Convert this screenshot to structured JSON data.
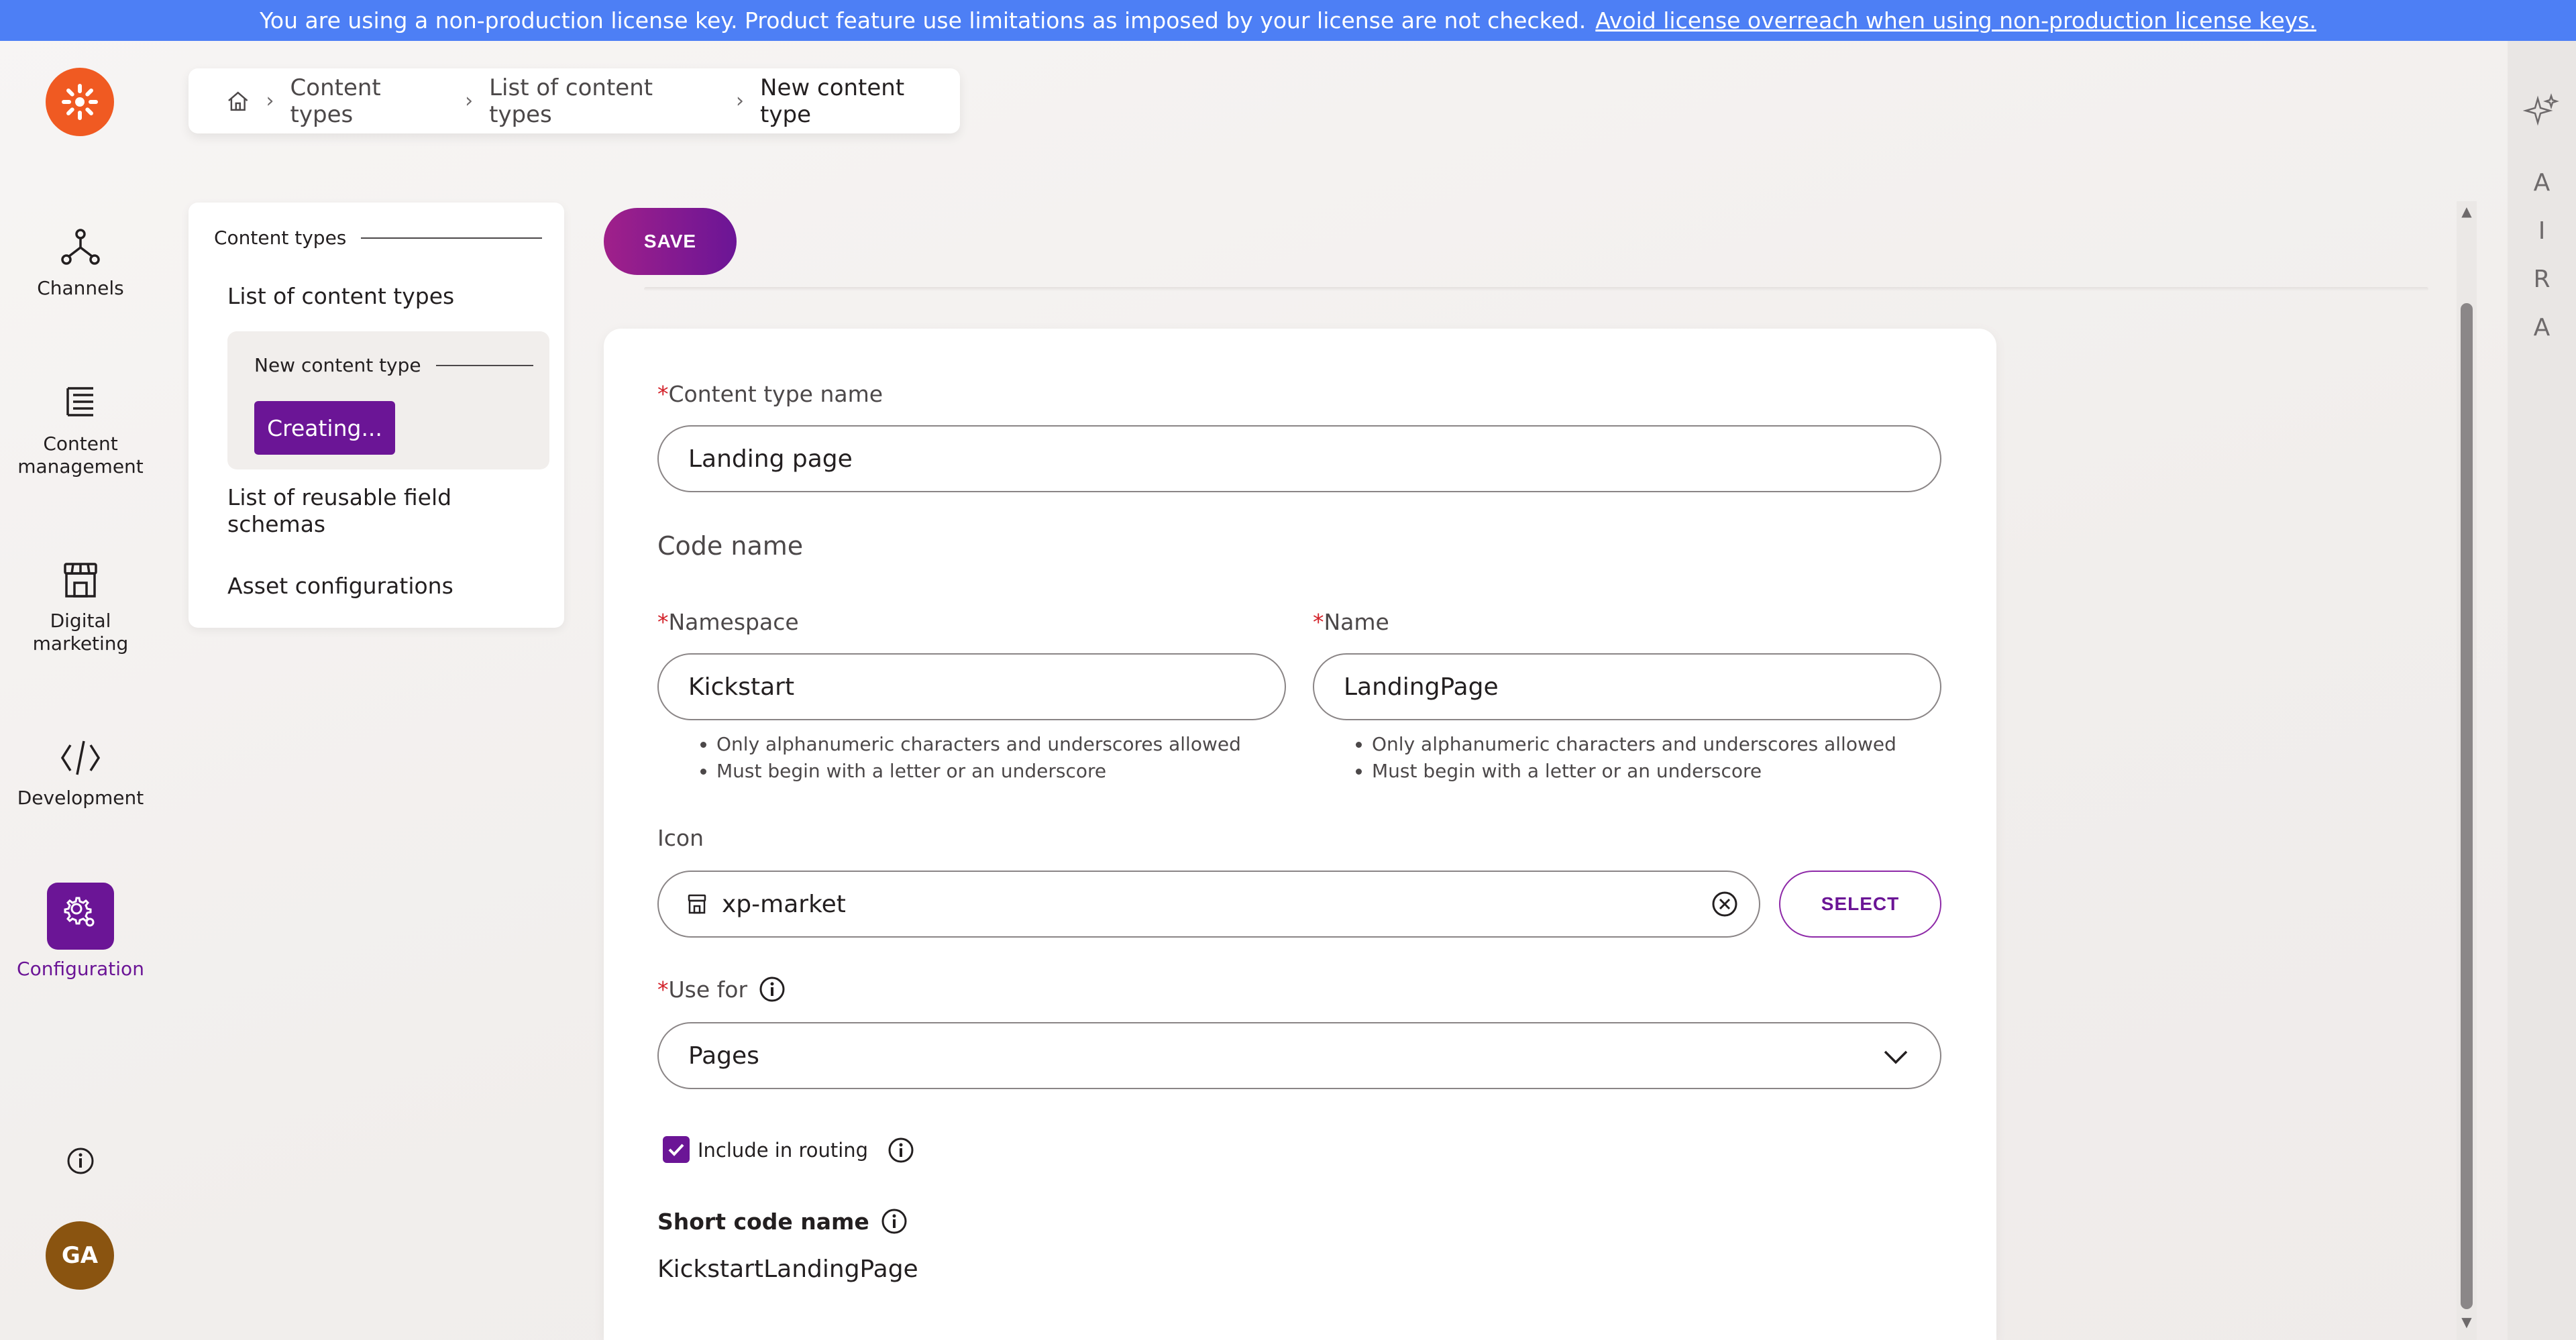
{
  "banner": {
    "text": "You are using a non-production license key. Product feature use limitations as imposed by your license are not checked.",
    "link": "Avoid license overreach when using non-production license keys."
  },
  "leftnav": {
    "items": [
      {
        "label": "Channels",
        "icon": "channels-icon"
      },
      {
        "label": "Content management",
        "icon": "content-management-icon"
      },
      {
        "label": "Digital marketing",
        "icon": "digital-marketing-icon"
      },
      {
        "label": "Development",
        "icon": "code-icon"
      },
      {
        "label": "Configuration",
        "icon": "gear-icon"
      }
    ],
    "avatar": "GA"
  },
  "breadcrumb": {
    "items": [
      "Content types",
      "List of content types",
      "New content type"
    ]
  },
  "subnav": {
    "heading": "Content types",
    "list_link": "List of content types",
    "group_heading": "New content type",
    "creating": "Creating...",
    "reusable_link": "List of reusable field schemas",
    "asset_link": "Asset configurations"
  },
  "toolbar": {
    "save_label": "SAVE"
  },
  "form": {
    "required_mark": "*",
    "content_type_name_label": "Content type name",
    "content_type_name_value": "Landing page",
    "code_name_title": "Code name",
    "namespace_label": "Namespace",
    "namespace_value": "Kickstart",
    "name_label": "Name",
    "name_value": "LandingPage",
    "hints": [
      "Only alphanumeric characters and underscores allowed",
      "Must begin with a letter or an underscore"
    ],
    "icon_label": "Icon",
    "icon_value": "xp-market",
    "select_label": "SELECT",
    "use_for_label": "Use for",
    "use_for_value": "Pages",
    "include_routing_label": "Include in routing",
    "short_code_name_label": "Short code name",
    "short_code_name_value": "KickstartLandingPage"
  },
  "aira": {
    "letters": [
      "A",
      "I",
      "R",
      "A"
    ]
  },
  "colors": {
    "accent": "#6b1596",
    "banner": "#4d7ff5",
    "logo": "#f05a22",
    "required": "#d3222a"
  }
}
